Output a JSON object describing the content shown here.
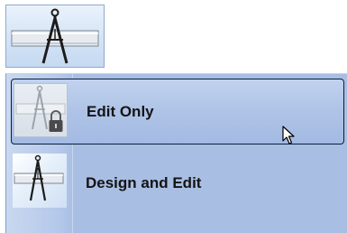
{
  "ribbon": {
    "mode_button_icon": "drafting-compass-icon"
  },
  "menu": {
    "items": [
      {
        "label": "Edit Only",
        "icon": "compass-lock-icon",
        "state": "hovered"
      },
      {
        "label": "Design and Edit",
        "icon": "drafting-compass-icon",
        "state": "normal"
      }
    ]
  },
  "colors": {
    "menu_background": "#a9bee3",
    "hover_border": "#0b1f3a",
    "button_border": "#8fa9cf"
  }
}
